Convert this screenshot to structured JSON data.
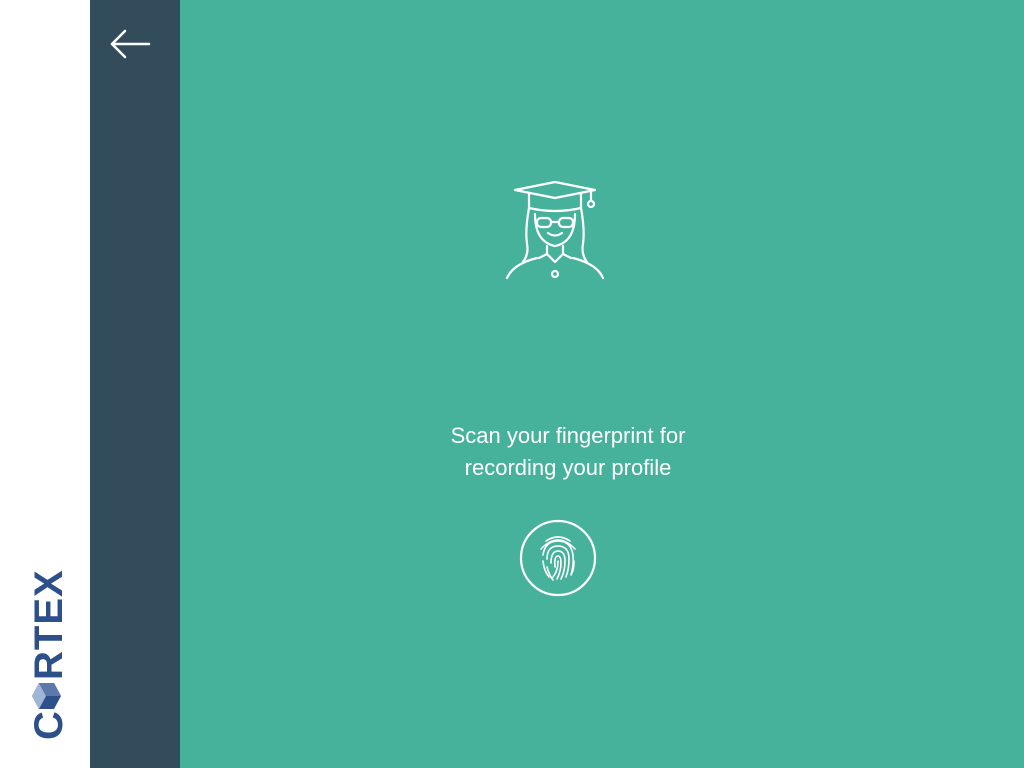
{
  "brand": {
    "logo_text": "CORTEX"
  },
  "navigation": {
    "back_icon": "arrow-left-icon"
  },
  "main": {
    "avatar_icon": "graduate-student-icon",
    "instruction_line1": "Scan your fingerprint for",
    "instruction_line2": "recording your profile",
    "fingerprint_icon": "fingerprint-icon"
  },
  "colors": {
    "background": "#47b29c",
    "nav_panel": "#334c5b",
    "brand_bar": "#ffffff",
    "logo_blue": "#2d4f8a",
    "foreground": "#ffffff"
  }
}
